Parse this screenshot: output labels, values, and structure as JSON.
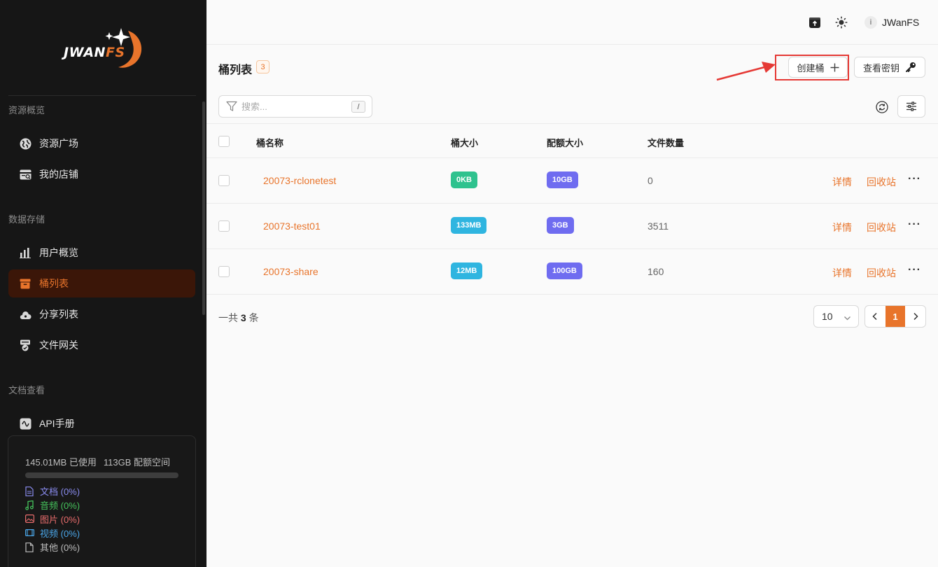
{
  "brand": {
    "logo_main": "JWAN",
    "logo_accent": "FS"
  },
  "sidebar": {
    "sections": [
      {
        "label": "资源概览"
      },
      {
        "label": "数据存储"
      },
      {
        "label": "文档查看"
      }
    ],
    "items": [
      {
        "label": "资源广场",
        "icon": "globe-icon"
      },
      {
        "label": "我的店铺",
        "icon": "store-icon"
      },
      {
        "label": "用户概览",
        "icon": "bar-chart-icon"
      },
      {
        "label": "桶列表",
        "icon": "bucket-icon",
        "active": true
      },
      {
        "label": "分享列表",
        "icon": "cloud-share-icon"
      },
      {
        "label": "文件网关",
        "icon": "gateway-icon"
      },
      {
        "label": "API手册",
        "icon": "api-icon"
      }
    ],
    "storage": {
      "used": "145.01MB 已使用",
      "quota": "113GB 配额空间",
      "used_fraction": 0.0,
      "categories": [
        {
          "label": "文档 (0%)",
          "color": "#8a8cf0",
          "icon": "document-icon"
        },
        {
          "label": "音频 (0%)",
          "color": "#45c35c",
          "icon": "music-icon"
        },
        {
          "label": "图片 (0%)",
          "color": "#e86c6c",
          "icon": "image-icon"
        },
        {
          "label": "视频 (0%)",
          "color": "#4aa6e8",
          "icon": "video-icon"
        },
        {
          "label": "其他 (0%)",
          "color": "#bdbdbd",
          "icon": "file-icon"
        }
      ]
    }
  },
  "header": {
    "user_initial": "i",
    "username": "JWanFS"
  },
  "main": {
    "title": "桶列表",
    "count": "3",
    "create_label": "创建桶",
    "view_keys_label": "查看密钥",
    "search_placeholder": "搜索...",
    "search_shortcut": "/",
    "columns": [
      "桶名称",
      "桶大小",
      "配额大小",
      "文件数量"
    ],
    "rows": [
      {
        "name": "20073-rclonetest",
        "size": "0KB",
        "quota": "10GB",
        "files": "0"
      },
      {
        "name": "20073-test01",
        "size": "133MB",
        "quota": "3GB",
        "files": "3511"
      },
      {
        "name": "20073-share",
        "size": "12MB",
        "quota": "100GB",
        "files": "160"
      }
    ],
    "actions": {
      "detail": "详情",
      "recycle": "回收站"
    },
    "footer": {
      "total_prefix": "一共",
      "total_count": "3",
      "total_suffix": "条",
      "page_size": "10",
      "current_page": "1"
    }
  },
  "colors": {
    "accent": "#e8742b",
    "size_tag": "#2fb5e0",
    "size_tag_zero": "#2ec28e",
    "quota_tag": "#6f6cf0",
    "sidebar_bg": "#161616"
  }
}
